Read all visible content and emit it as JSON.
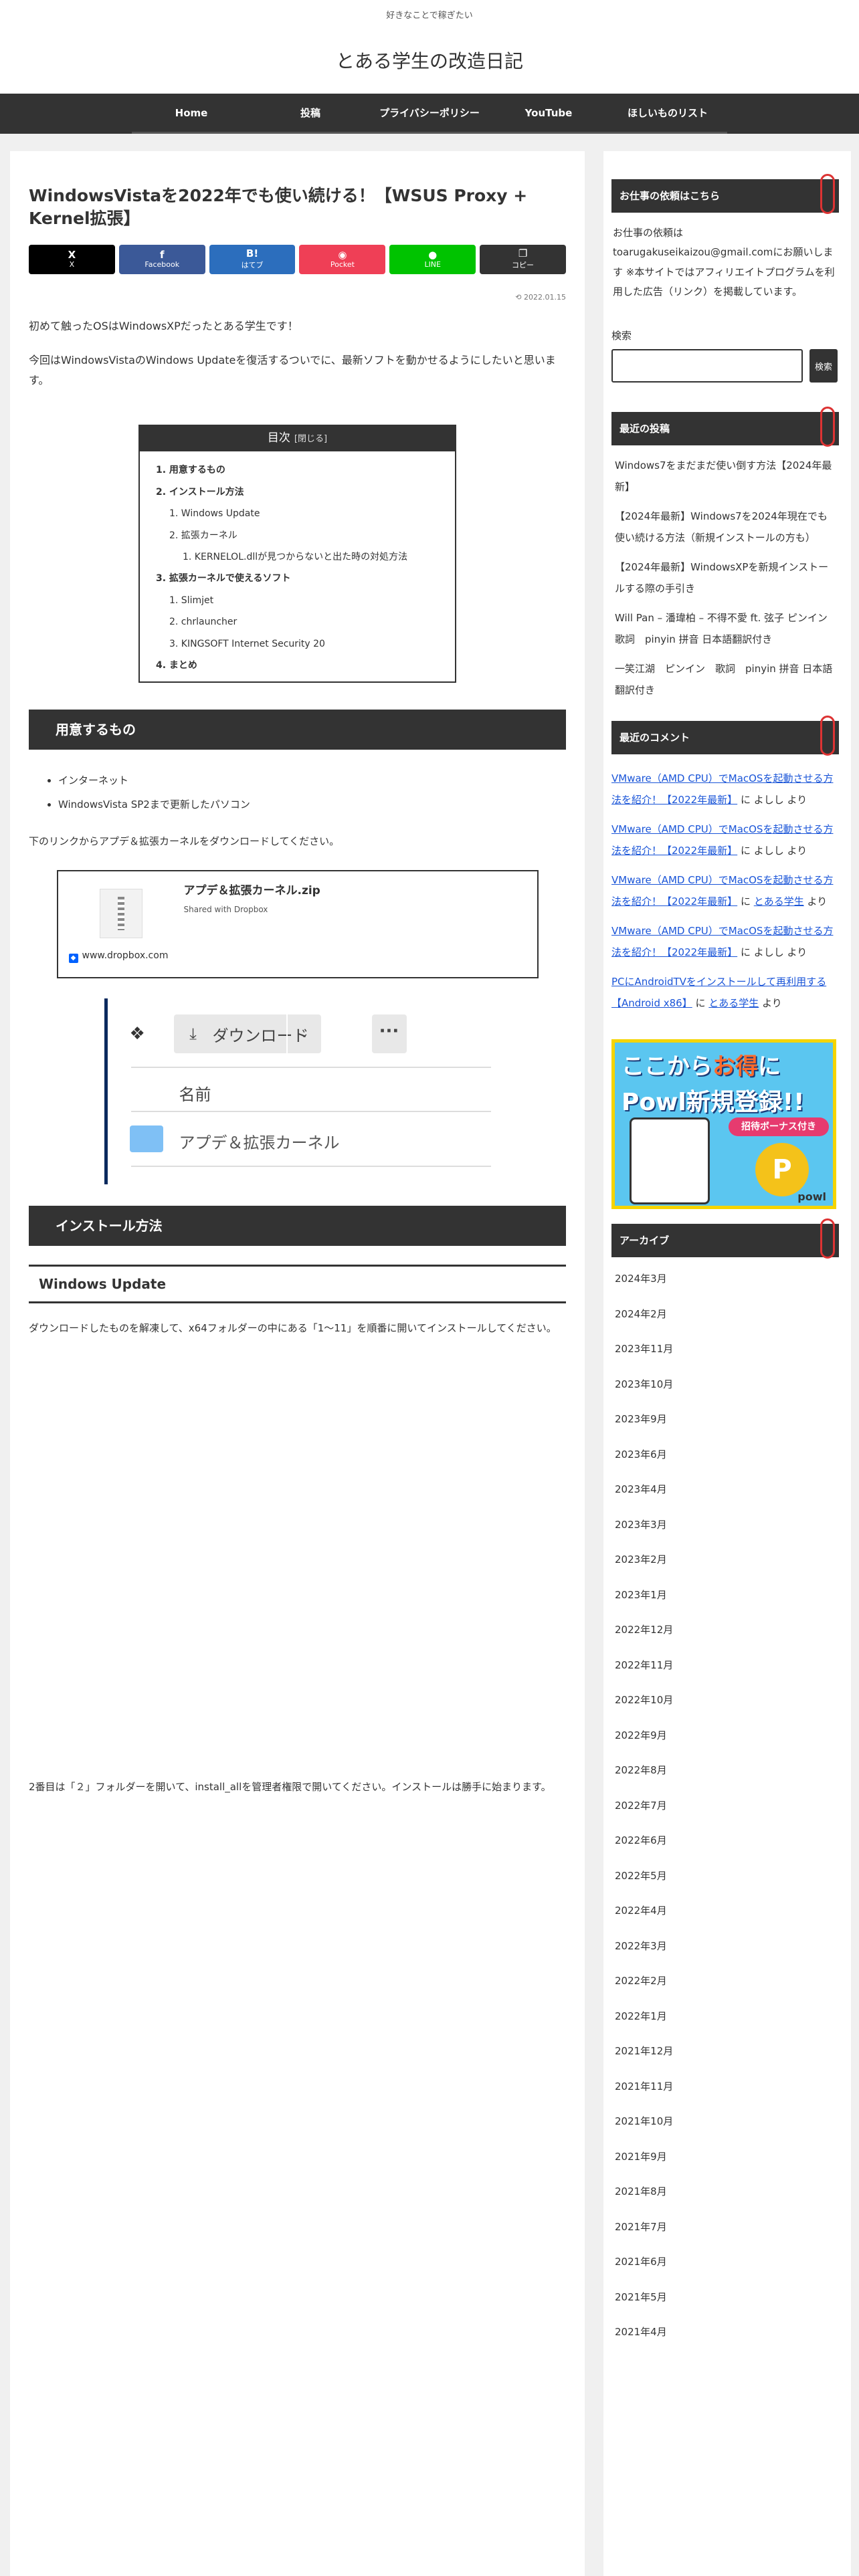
{
  "header": {
    "tagline": "好きなことで稼ぎたい",
    "site_title": "とある学生の改造日記"
  },
  "nav": {
    "items": [
      "Home",
      "投稿",
      "プライバシーポリシー",
      "YouTube",
      "ほしいものリスト"
    ]
  },
  "article": {
    "title": "WindowsVistaを2022年でも使い続ける！【WSUS Proxy + Kernel拡張】",
    "share": [
      {
        "icon": "X",
        "label": "X",
        "color": "#000000"
      },
      {
        "icon": "f",
        "label": "Facebook",
        "color": "#3b5998"
      },
      {
        "icon": "B!",
        "label": "はてブ",
        "color": "#2c6ebd"
      },
      {
        "icon": "◉",
        "label": "Pocket",
        "color": "#ef3f56"
      },
      {
        "icon": "●",
        "label": "LINE",
        "color": "#00c300"
      },
      {
        "icon": "❐",
        "label": "コピー",
        "color": "#333333"
      }
    ],
    "date": "2022.01.15",
    "intro1": "初めて触ったOSはWindowsXPだったとある学生です！",
    "intro2": "今回はWindowsVistaのWindows Updateを復活するついでに、最新ソフトを動かせるようにしたいと思います。",
    "toc": {
      "title": "目次",
      "toggle": "[閉じる]",
      "items": [
        {
          "text": "1. 用意するもの",
          "level": 1
        },
        {
          "text": "2. インストール方法",
          "level": 1
        },
        {
          "text": "1. Windows Update",
          "level": 2
        },
        {
          "text": "2. 拡張カーネル",
          "level": 2
        },
        {
          "text": "1. KERNELOL.dllが見つからないと出た時の対処方法",
          "level": 3
        },
        {
          "text": "3. 拡張カーネルで使えるソフト",
          "level": 1
        },
        {
          "text": "1. Slimjet",
          "level": 2
        },
        {
          "text": "2. chrlauncher",
          "level": 2
        },
        {
          "text": "3. KINGSOFT Internet Security 20",
          "level": 2
        },
        {
          "text": "4. まとめ",
          "level": 1
        }
      ]
    },
    "h2_prepare": "用意するもの",
    "bullets": [
      "インターネット",
      "WindowsVista SP2まで更新したパソコン"
    ],
    "download_text": "下のリンクからアプデ＆拡張カーネルをダウンロードしてください。",
    "dropbox": {
      "file_name": "アプデ＆拡張カーネル.zip",
      "subtitle": "Shared with Dropbox",
      "site": "www.dropbox.com"
    },
    "dropbox_shot": {
      "download": "ダウンロード",
      "name_col": "名前",
      "folder": "アプデ＆拡張カーネル"
    },
    "h2_install": "インストール方法",
    "h3_wu": "Windows Update",
    "wu_text": "ダウンロードしたものを解凍して、x64フォルダーの中にある「1〜11」を順番に開いてインストールしてください。",
    "wu_text2": "2番目は「２」フォルダーを開いて、install_allを管理者権限で開いてください。インストールは勝手に始まります。"
  },
  "sidebar": {
    "work": {
      "title": "お仕事の依頼はこちら",
      "text": "お仕事の依頼は toarugakuseikaizou@gmail.comにお願いします ※本サイトではアフィリエイトプログラムを利用した広告（リンク）を掲載しています。"
    },
    "search": {
      "label": "検索",
      "button": "検索"
    },
    "recent_posts": {
      "title": "最近の投稿",
      "items": [
        "Windows7をまだまだ使い倒す方法【2024年最新】",
        "【2024年最新】Windows7を2024年現在でも使い続ける方法（新規インストールの方も）",
        "【2024年最新】WindowsXPを新規インストールする際の手引き",
        "Will Pan – 潘瑋柏 – 不得不愛 ft. 弦子 ピンイン　歌詞　pinyin 拼音 日本語翻訳付き",
        "一笑江湖　ピンイン　歌詞　pinyin 拼音 日本語翻訳付き"
      ]
    },
    "recent_comments": {
      "title": "最近のコメント",
      "items": [
        {
          "post": "VMware（AMD CPU）でMacOSを起動させる方法を紹介！【2022年最新】",
          "mid": " に ",
          "author": "よしし",
          "author_link": false,
          "tail": " より"
        },
        {
          "post": "VMware（AMD CPU）でMacOSを起動させる方法を紹介！【2022年最新】",
          "mid": " に ",
          "author": "よしし",
          "author_link": false,
          "tail": " より"
        },
        {
          "post": "VMware（AMD CPU）でMacOSを起動させる方法を紹介！【2022年最新】",
          "mid": " に ",
          "author": "とある学生",
          "author_link": true,
          "tail": " より"
        },
        {
          "post": "VMware（AMD CPU）でMacOSを起動させる方法を紹介！【2022年最新】",
          "mid": " に ",
          "author": "よしし",
          "author_link": false,
          "tail": " より"
        },
        {
          "post": "PCにAndroidTVをインストールして再利用する【Android x86】",
          "mid": " に ",
          "author": "とある学生",
          "author_link": true,
          "tail": " より"
        }
      ]
    },
    "banner": {
      "line1a": "ここから",
      "line1b": "お得",
      "line1c": "に",
      "line2": "Powl新規登録!!",
      "badge": "招待ボーナス付き",
      "brand": "powl"
    },
    "archive": {
      "title": "アーカイブ",
      "items": [
        "2024年3月",
        "2024年2月",
        "2023年11月",
        "2023年10月",
        "2023年9月",
        "2023年6月",
        "2023年4月",
        "2023年3月",
        "2023年2月",
        "2023年1月",
        "2022年12月",
        "2022年11月",
        "2022年10月",
        "2022年9月",
        "2022年8月",
        "2022年7月",
        "2022年6月",
        "2022年5月",
        "2022年4月",
        "2022年3月",
        "2022年2月",
        "2022年1月",
        "2021年12月",
        "2021年11月",
        "2021年10月",
        "2021年9月",
        "2021年8月",
        "2021年7月",
        "2021年6月",
        "2021年5月",
        "2021年4月"
      ]
    }
  },
  "colors": {
    "dark_bar": "#333333",
    "link": "#1a55d8",
    "clip": "#dd3333"
  }
}
